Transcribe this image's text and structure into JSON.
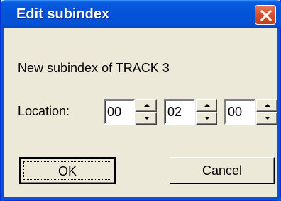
{
  "window": {
    "title": "Edit subindex",
    "close_icon": "close-icon"
  },
  "message": "New subindex of TRACK 3",
  "location": {
    "label": "Location:",
    "fields": [
      {
        "value": "00"
      },
      {
        "value": "02"
      },
      {
        "value": "00"
      }
    ]
  },
  "buttons": {
    "ok": "OK",
    "cancel": "Cancel"
  },
  "colors": {
    "titlebar": "#0453d9",
    "close": "#d7522f",
    "face": "#ece9d8"
  }
}
